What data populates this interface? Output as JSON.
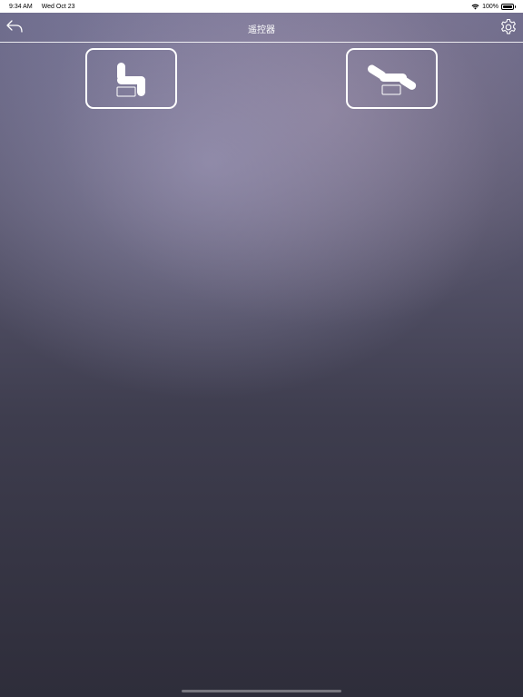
{
  "status_bar": {
    "time": "9:34 AM",
    "date": "Wed Oct 23",
    "battery": "100%",
    "battery_level": 1.0,
    "icons": [
      "wifi-icon",
      "battery-icon"
    ]
  },
  "nav": {
    "title": "遥控器",
    "back_icon": "back-arrow-icon",
    "settings_icon": "gear-icon"
  },
  "modes": [
    {
      "name": "upright-chair-mode",
      "icon": "upright-chair-icon"
    },
    {
      "name": "reclined-chair-mode",
      "icon": "reclined-chair-icon"
    }
  ],
  "colors": {
    "foreground": "#ffffff",
    "status_bar_bg": "#ffffff"
  }
}
